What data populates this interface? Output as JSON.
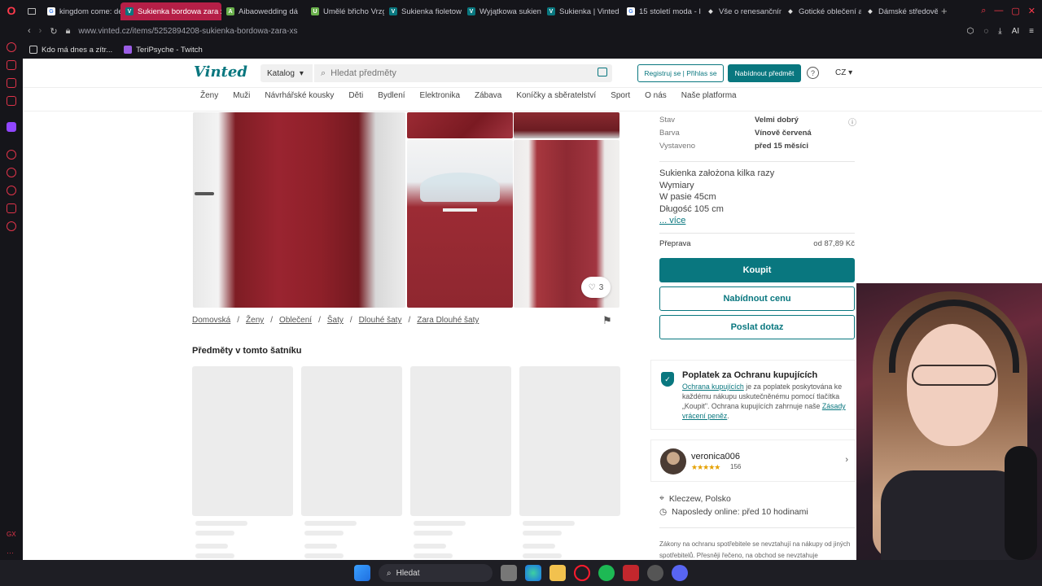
{
  "browser": {
    "tabs": [
      {
        "label": "kingdom come: de",
        "color": "#4285f4",
        "glyph": "G"
      },
      {
        "label": "Sukienka bordowa zara xs",
        "color": "#09777f",
        "glyph": "V",
        "active": true
      },
      {
        "label": "Aibaowedding dá",
        "color": "#6ab04c",
        "glyph": "A"
      },
      {
        "label": "Umělé břicho Vrzg",
        "color": "#6ab04c",
        "glyph": "U"
      },
      {
        "label": "Sukienka fioletow",
        "color": "#09777f",
        "glyph": "V"
      },
      {
        "label": "Wyjątkowa sukien",
        "color": "#09777f",
        "glyph": "V"
      },
      {
        "label": "Sukienka | Vinted",
        "color": "#09777f",
        "glyph": "V"
      },
      {
        "label": "15 století moda - I",
        "color": "#4285f4",
        "glyph": "G"
      },
      {
        "label": "Vše o renesančním",
        "color": "#888",
        "glyph": "◆"
      },
      {
        "label": "Gotické oblečení a",
        "color": "#888",
        "glyph": "◆"
      },
      {
        "label": "Dámské středověk",
        "color": "#888",
        "glyph": "◆"
      }
    ],
    "url": "www.vinted.cz/items/5252894208-sukienka-bordowa-zara-xs",
    "bookmarks": [
      "Kdo má dnes a zítr...",
      "TeriPsyche - Twitch"
    ],
    "ai_label": "AI"
  },
  "header": {
    "logo": "Vinted",
    "catalog": "Katalog",
    "search_placeholder": "Hledat předměty",
    "register": "Registruj se | Přihlas se",
    "sell": "Nabídnout předmět",
    "help": "?",
    "lang": "CZ"
  },
  "categories": [
    "Ženy",
    "Muži",
    "Návrhářské kousky",
    "Děti",
    "Bydlení",
    "Elektronika",
    "Zábava",
    "Koníčky a sběratelství",
    "Sport",
    "O nás",
    "Naše platforma"
  ],
  "gallery": {
    "likes": "3"
  },
  "breadcrumb": [
    "Domovská",
    "Ženy",
    "Oblečení",
    "Šaty",
    "Dlouhé šaty",
    "Zara Dlouhé šaty"
  ],
  "wardrobe_title": "Předměty v tomto šatníku",
  "details": [
    {
      "key": "Stav",
      "value": "Velmi dobrý"
    },
    {
      "key": "Barva",
      "value": "Vínově červená"
    },
    {
      "key": "Vystaveno",
      "value": "před 15 měsíci"
    }
  ],
  "description": {
    "lines": [
      "Sukienka założona kilka razy",
      "Wymiary",
      "W pasie 45cm",
      "Długość 105 cm"
    ],
    "more": "... více"
  },
  "shipping": {
    "label": "Přeprava",
    "value": "od 87,89 Kč"
  },
  "actions": {
    "buy": "Koupit",
    "offer": "Nabídnout cenu",
    "ask": "Poslat dotaz"
  },
  "protection": {
    "title": "Poplatek za Ochranu kupujících",
    "link1": "Ochrana kupujících",
    "text1": " je za poplatek poskytována ke každému nákupu uskutečněnému pomocí tlačítka „Koupit\". Ochrana kupujících zahrnuje naše ",
    "link2": "Zásady vrácení peněz",
    "text2": "."
  },
  "seller": {
    "name": "veronica006",
    "stars": "★★★★★",
    "reviews": "156",
    "location": "Kleczew, Polsko",
    "online": "Naposledy online: před 10 hodinami"
  },
  "legal": "Zákony na ochranu spotřebitele se nevztahují na nákupy od jiných spotřebitelů. Přesněji řečeno, na obchod se nevztahuje",
  "taskbar": {
    "search": "Hledat"
  }
}
